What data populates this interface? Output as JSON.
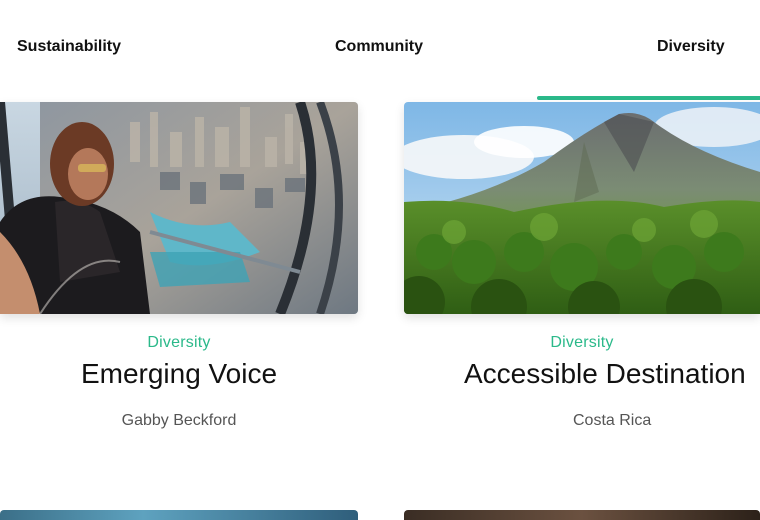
{
  "tabs": [
    {
      "label": "Sustainability"
    },
    {
      "label": "Community"
    },
    {
      "label": "Diversity",
      "active": true
    }
  ],
  "colors": {
    "accent": "#2bb98a",
    "text": "#111111",
    "muted": "#555555"
  },
  "cards": [
    {
      "category": "Diversity",
      "title": "Emerging Voice",
      "subtitle": "Gabby Beckford",
      "image": "woman-on-skyscraper-observation-deck-photo"
    },
    {
      "category": "Diversity",
      "title": "Accessible Destination",
      "subtitle": "Costa Rica",
      "image": "volcano-landscape-photo"
    }
  ]
}
